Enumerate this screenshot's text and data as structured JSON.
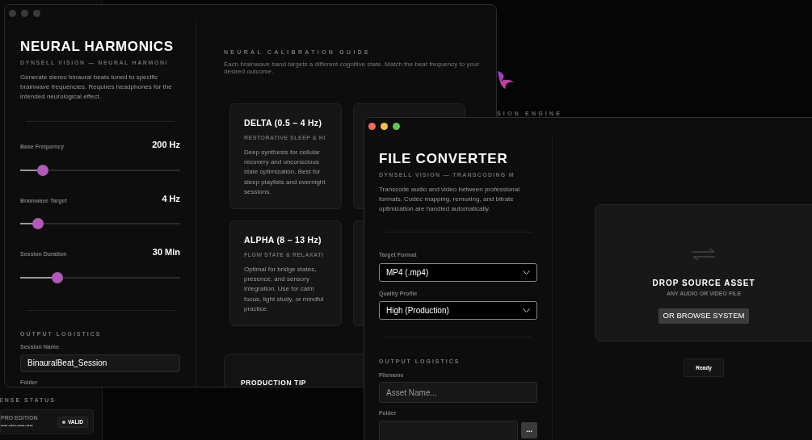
{
  "background_app": {
    "tagline": "SION ENGINE",
    "license": {
      "section_title": "ENSE STATUS",
      "edition": "PRO EDITION",
      "key": "••••-••••-••••-••••",
      "status": "VALID"
    }
  },
  "neural_window": {
    "active": false,
    "title": "NEURAL HARMONICS",
    "subtitle": "DYNSELL VISION — NEURAL HARMONI",
    "description": "Generate stereo binaural beats tuned to specific brainwave frequencies. Requires headphones for the intended neurological effect.",
    "sliders": [
      {
        "label": "Base Frequency",
        "reading": "200 Hz",
        "level": 0.14
      },
      {
        "label": "Brainwave Target",
        "reading": "4 Hz",
        "level": 0.11
      },
      {
        "label": "Session Duration",
        "reading": "30 Min",
        "level": 0.23
      }
    ],
    "output": {
      "section_title": "OUTPUT LOGISTICS",
      "session_label": "Session Name",
      "session_value": "BinauralBeat_Session",
      "folder_label": "Folder"
    },
    "guide": {
      "title": "NEURAL CALIBRATION GUIDE",
      "description": "Each brainwave band targets a different cognitive state. Match the beat frequency to your desired outcome.",
      "cards": [
        {
          "kind": "text",
          "title": "DELTA (0.5 – 4 Hz)",
          "subtitle": "RESTORATIVE SLEEP & HI",
          "body": "Deep synthesis for cellular recovery and unconscious state optimization. Best for sleep playlists and overnight sessions."
        },
        {
          "kind": "hidden"
        },
        {
          "kind": "text",
          "title": "ALPHA (8 – 13 Hz)",
          "subtitle": "FLOW STATE & RELAXATI",
          "body": "Optimal for bridge states, presence, and sensory integration. Use for calm focus, light study, or mindful practice."
        },
        {
          "kind": "hidden"
        }
      ],
      "tip_title": "PRODUCTION TIP"
    }
  },
  "converter_window": {
    "active": true,
    "title": "FILE CONVERTER",
    "subtitle": "DYNSELL VISION — TRANSCODING M",
    "description": "Transcode audio and video between professional formats. Codec mapping, remuxing, and bitrate optimization are handled automatically.",
    "selects": [
      {
        "label": "Target Format",
        "value": "MP4 (.mp4)"
      },
      {
        "label": "Quality Profile",
        "value": "High (Production)"
      }
    ],
    "output": {
      "section_title": "OUTPUT LOGISTICS",
      "filename_label": "Filename",
      "filename_placeholder": "Asset Name...",
      "folder_label": "Folder",
      "browse_button": "..."
    },
    "drop_zone": {
      "title": "DROP SOURCE ASSET",
      "hint": "ANY AUDIO OR VIDEO FILE",
      "button": "OR BROWSE SYSTEM"
    },
    "status": "Ready"
  }
}
